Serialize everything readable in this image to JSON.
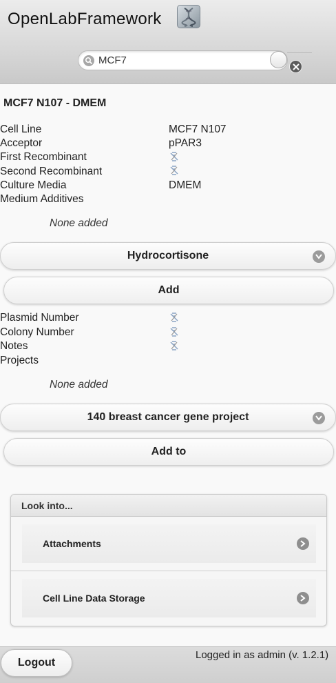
{
  "header": {
    "app_title": "OpenLabFramework",
    "logo_icon": "dna-helix-icon"
  },
  "search": {
    "value": "MCF7",
    "placeholder": ""
  },
  "record": {
    "title": "MCF7 N107 - DMEM",
    "fields": [
      {
        "label": "Cell Line",
        "value": "MCF7 N107"
      },
      {
        "label": "Acceptor",
        "value": "pPAR3"
      },
      {
        "label": "First Recombinant",
        "value": null,
        "icon": "not-available-icon"
      },
      {
        "label": "Second Recombinant",
        "value": null,
        "icon": "not-available-icon"
      },
      {
        "label": "Culture Media",
        "value": "DMEM"
      },
      {
        "label": "Medium Additives",
        "value": null
      }
    ],
    "additives": {
      "empty_text": "None added",
      "selected_option": "Hydrocortisone",
      "add_label": "Add"
    },
    "fields2": [
      {
        "label": "Plasmid Number",
        "value": null,
        "icon": "not-available-icon"
      },
      {
        "label": "Colony Number",
        "value": null,
        "icon": "not-available-icon"
      },
      {
        "label": "Notes",
        "value": null,
        "icon": "not-available-icon"
      },
      {
        "label": "Projects",
        "value": null
      }
    ],
    "projects": {
      "empty_text": "None added",
      "selected_option": "140 breast cancer gene project",
      "add_label": "Add to"
    }
  },
  "look_into": {
    "title": "Look into...",
    "items": [
      {
        "label": "Attachments"
      },
      {
        "label": "Cell Line Data Storage"
      }
    ]
  },
  "footer": {
    "logout_label": "Logout",
    "status": "Logged in as admin (v. 1.2.1)"
  }
}
